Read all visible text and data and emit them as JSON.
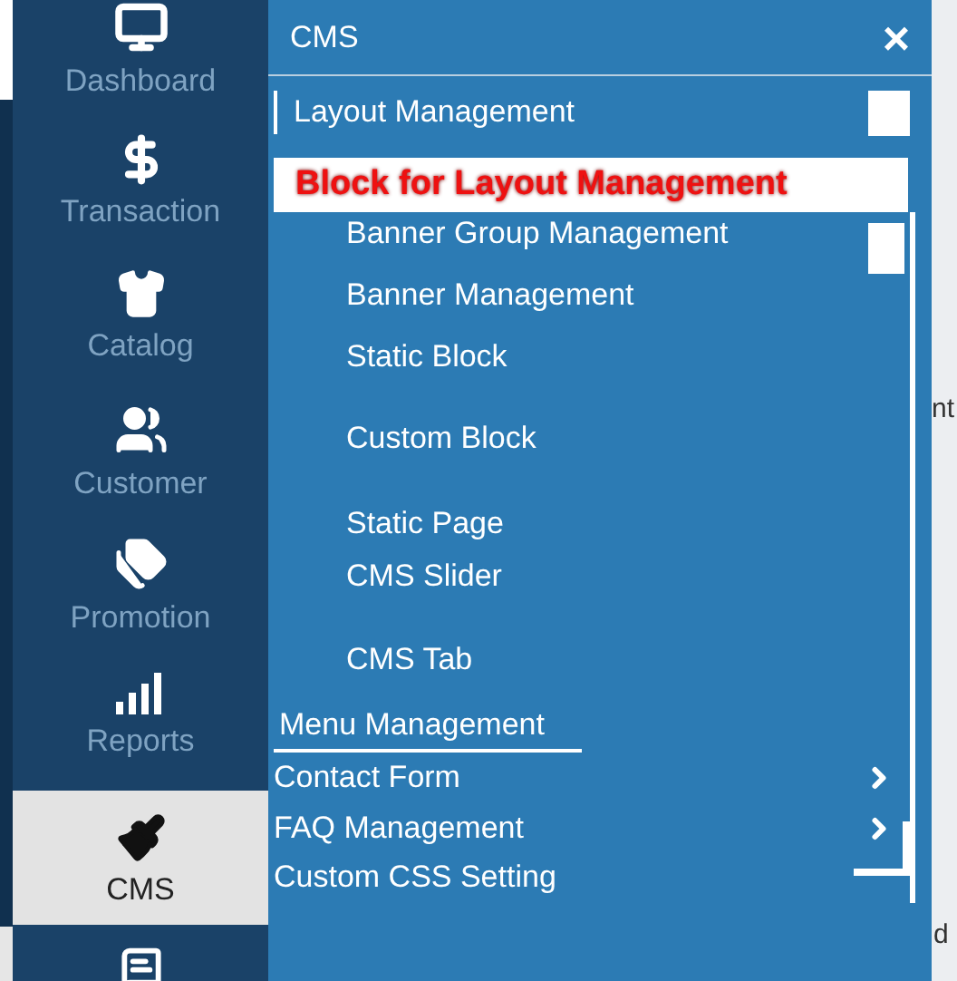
{
  "sidebar": {
    "items": [
      {
        "label": "Dashboard",
        "selected": false
      },
      {
        "label": "Transaction",
        "selected": false
      },
      {
        "label": "Catalog",
        "selected": false
      },
      {
        "label": "Customer",
        "selected": false
      },
      {
        "label": "Promotion",
        "selected": false
      },
      {
        "label": "Reports",
        "selected": false
      },
      {
        "label": "CMS",
        "selected": true
      },
      {
        "selected": false
      }
    ]
  },
  "panel": {
    "title": "CMS",
    "close": "×",
    "section": {
      "label": "Layout Management"
    },
    "annotation": "Block for Layout Management",
    "items": [
      {
        "kind": "sub",
        "label": "Banner Group Management"
      },
      {
        "kind": "sub",
        "label": "Banner Management"
      },
      {
        "kind": "sub",
        "label": "Static Block"
      },
      {
        "kind": "sub",
        "label": "Custom Block"
      },
      {
        "kind": "sub",
        "label": "Static Page"
      },
      {
        "kind": "sub",
        "label": "CMS Slider"
      },
      {
        "kind": "sub",
        "label": "CMS Tab"
      },
      {
        "kind": "heading",
        "label": "Menu Management"
      },
      {
        "kind": "link",
        "label": "Contact Form",
        "chevron": true
      },
      {
        "kind": "link",
        "label": "FAQ Management",
        "chevron": true
      },
      {
        "kind": "link",
        "label": "Custom CSS Setting",
        "chevron": false
      }
    ]
  },
  "page_fragments": [
    "nt",
    "d"
  ]
}
